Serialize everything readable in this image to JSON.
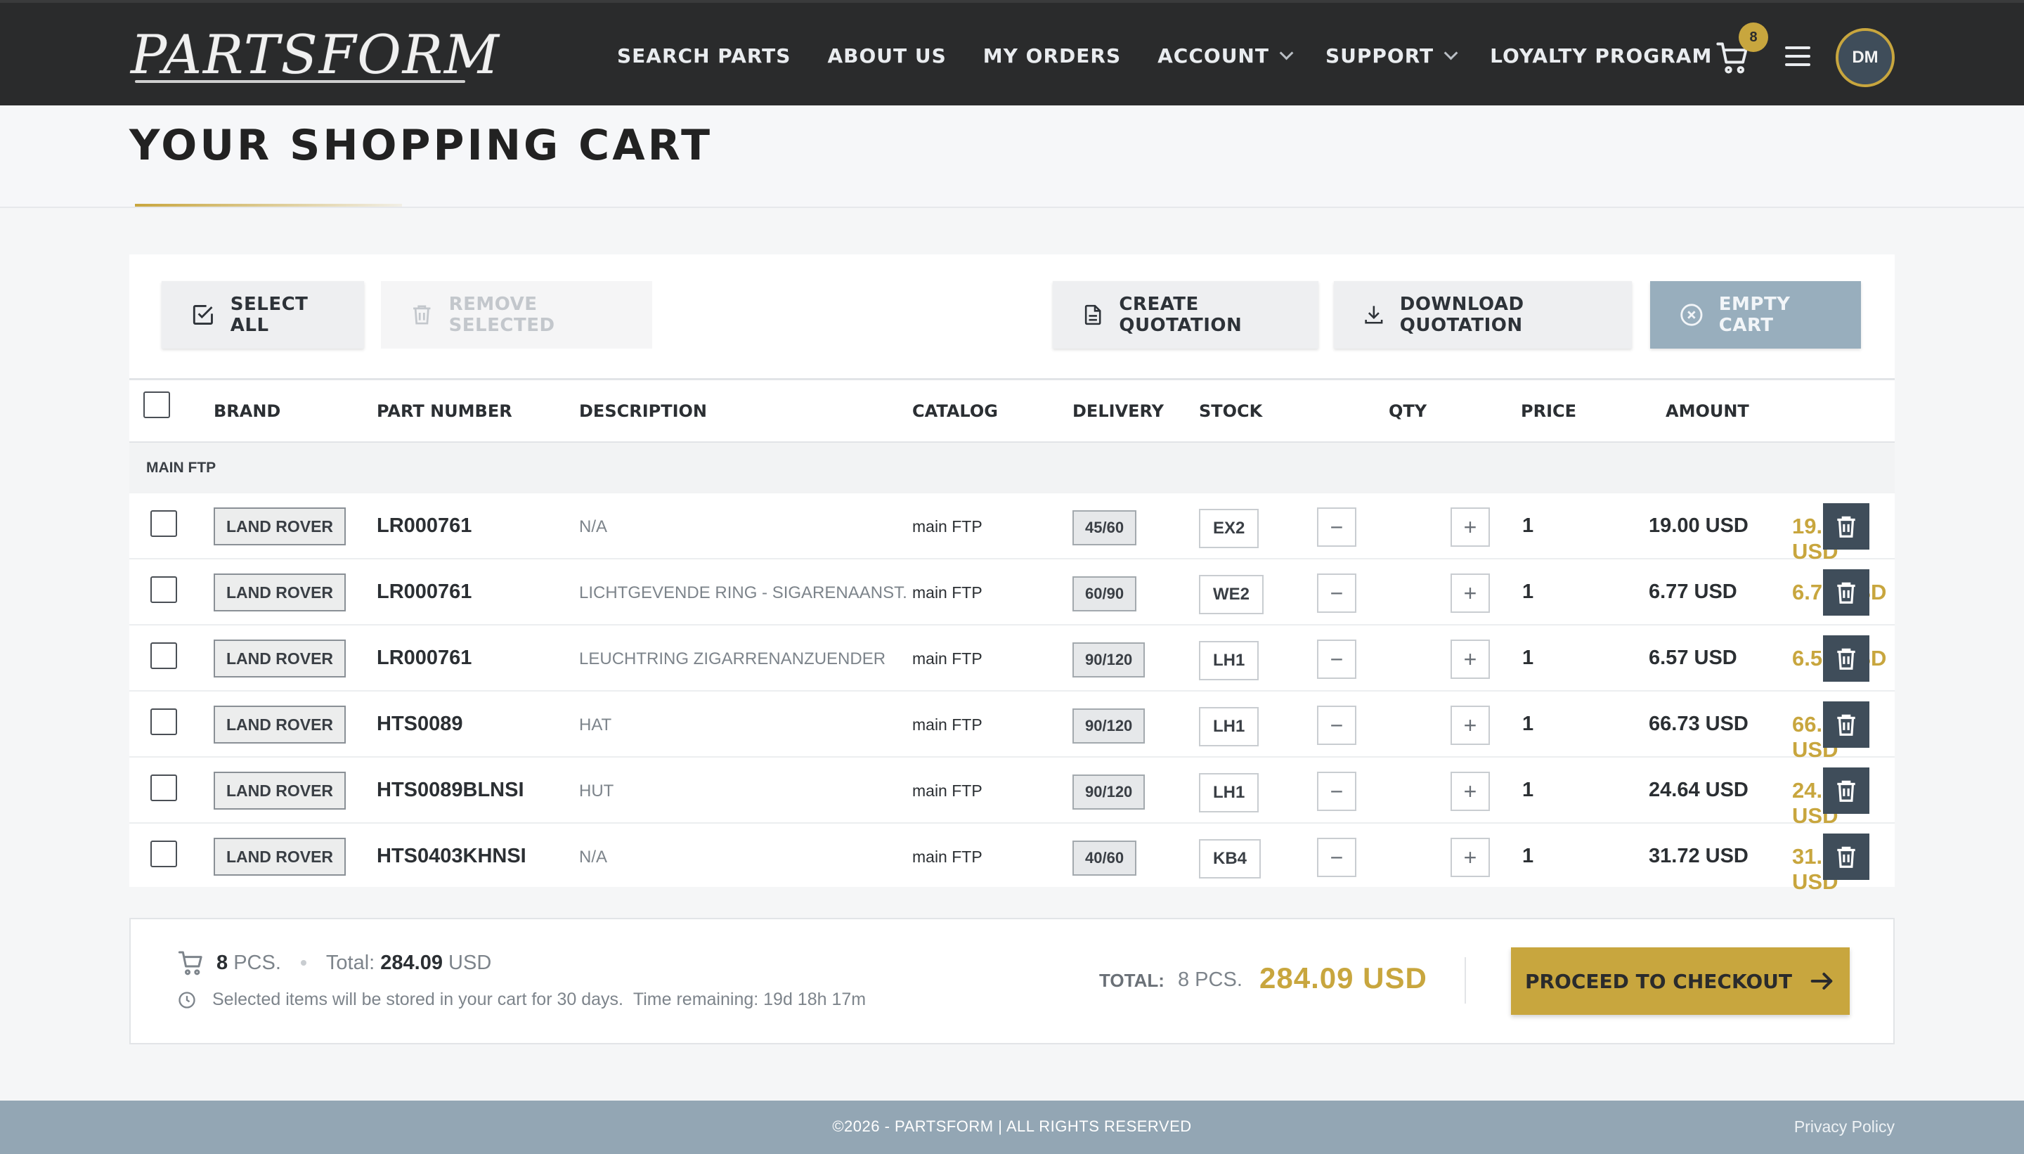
{
  "header": {
    "logo_text": "PARTSFORM",
    "nav": [
      "SEARCH PARTS",
      "ABOUT US",
      "MY ORDERS",
      "ACCOUNT",
      "SUPPORT",
      "LOYALTY PROGRAM"
    ],
    "cart_count": "8",
    "avatar_initials": "DM",
    "brand_gold": "#c8a63e",
    "icons": [
      "cart-icon",
      "hamburger-menu-icon",
      "chevron-down-icon"
    ]
  },
  "page_title": "YOUR SHOPPING CART",
  "toolbar": {
    "select_all": "SELECT ALL",
    "remove_selected": "REMOVE SELECTED",
    "create_quotation": "CREATE QUOTATION",
    "download_quotation": "DOWNLOAD QUOTATION",
    "empty_cart": "EMPTY CART"
  },
  "table": {
    "columns": [
      "BRAND",
      "PART NUMBER",
      "DESCRIPTION",
      "CATALOG",
      "DELIVERY",
      "STOCK",
      "QTY",
      "PRICE",
      "AMOUNT"
    ],
    "group": "MAIN FTP",
    "rows": [
      {
        "brand": "LAND ROVER",
        "part": "LR000761",
        "desc": "N/A",
        "catalog": "main FTP",
        "delivery": "45/60",
        "stock": "EX2",
        "qty": "1",
        "price": "19.00 USD",
        "amount": "19.00 USD"
      },
      {
        "brand": "LAND ROVER",
        "part": "LR000761",
        "desc": "LICHTGEVENDE RING - SIGARENAANST.",
        "catalog": "main FTP",
        "delivery": "60/90",
        "stock": "WE2",
        "qty": "1",
        "price": "6.77 USD",
        "amount": "6.77 USD"
      },
      {
        "brand": "LAND ROVER",
        "part": "LR000761",
        "desc": "LEUCHTRING ZIGARRENANZUENDER",
        "catalog": "main FTP",
        "delivery": "90/120",
        "stock": "LH1",
        "qty": "1",
        "price": "6.57 USD",
        "amount": "6.57 USD"
      },
      {
        "brand": "LAND ROVER",
        "part": "HTS0089",
        "desc": "HAT",
        "catalog": "main FTP",
        "delivery": "90/120",
        "stock": "LH1",
        "qty": "1",
        "price": "66.73 USD",
        "amount": "66.73 USD"
      },
      {
        "brand": "LAND ROVER",
        "part": "HTS0089BLNSI",
        "desc": "HUT",
        "catalog": "main FTP",
        "delivery": "90/120",
        "stock": "LH1",
        "qty": "1",
        "price": "24.64 USD",
        "amount": "24.64 USD"
      },
      {
        "brand": "LAND ROVER",
        "part": "HTS0403KHNSI",
        "desc": "N/A",
        "catalog": "main FTP",
        "delivery": "40/60",
        "stock": "KB4",
        "qty": "1",
        "price": "31.72 USD",
        "amount": "31.72 USD"
      }
    ]
  },
  "summary": {
    "pcs_count": "8",
    "pcs_label": "PCS.",
    "total_label": "Total:",
    "total_value": "284.09",
    "currency": "USD",
    "storage_note": "Selected items will be stored in your cart for 30 days.",
    "time_remaining": "Time remaining: 19d 18h 17m",
    "grand_label": "TOTAL:",
    "grand_pcs": "8 PCS.",
    "grand_amount": "284.09 USD",
    "checkout": "PROCEED TO CHECKOUT"
  },
  "footer": {
    "copyright": "©2026 - PARTSFORM | ALL RIGHTS RESERVED",
    "privacy": "Privacy Policy"
  }
}
